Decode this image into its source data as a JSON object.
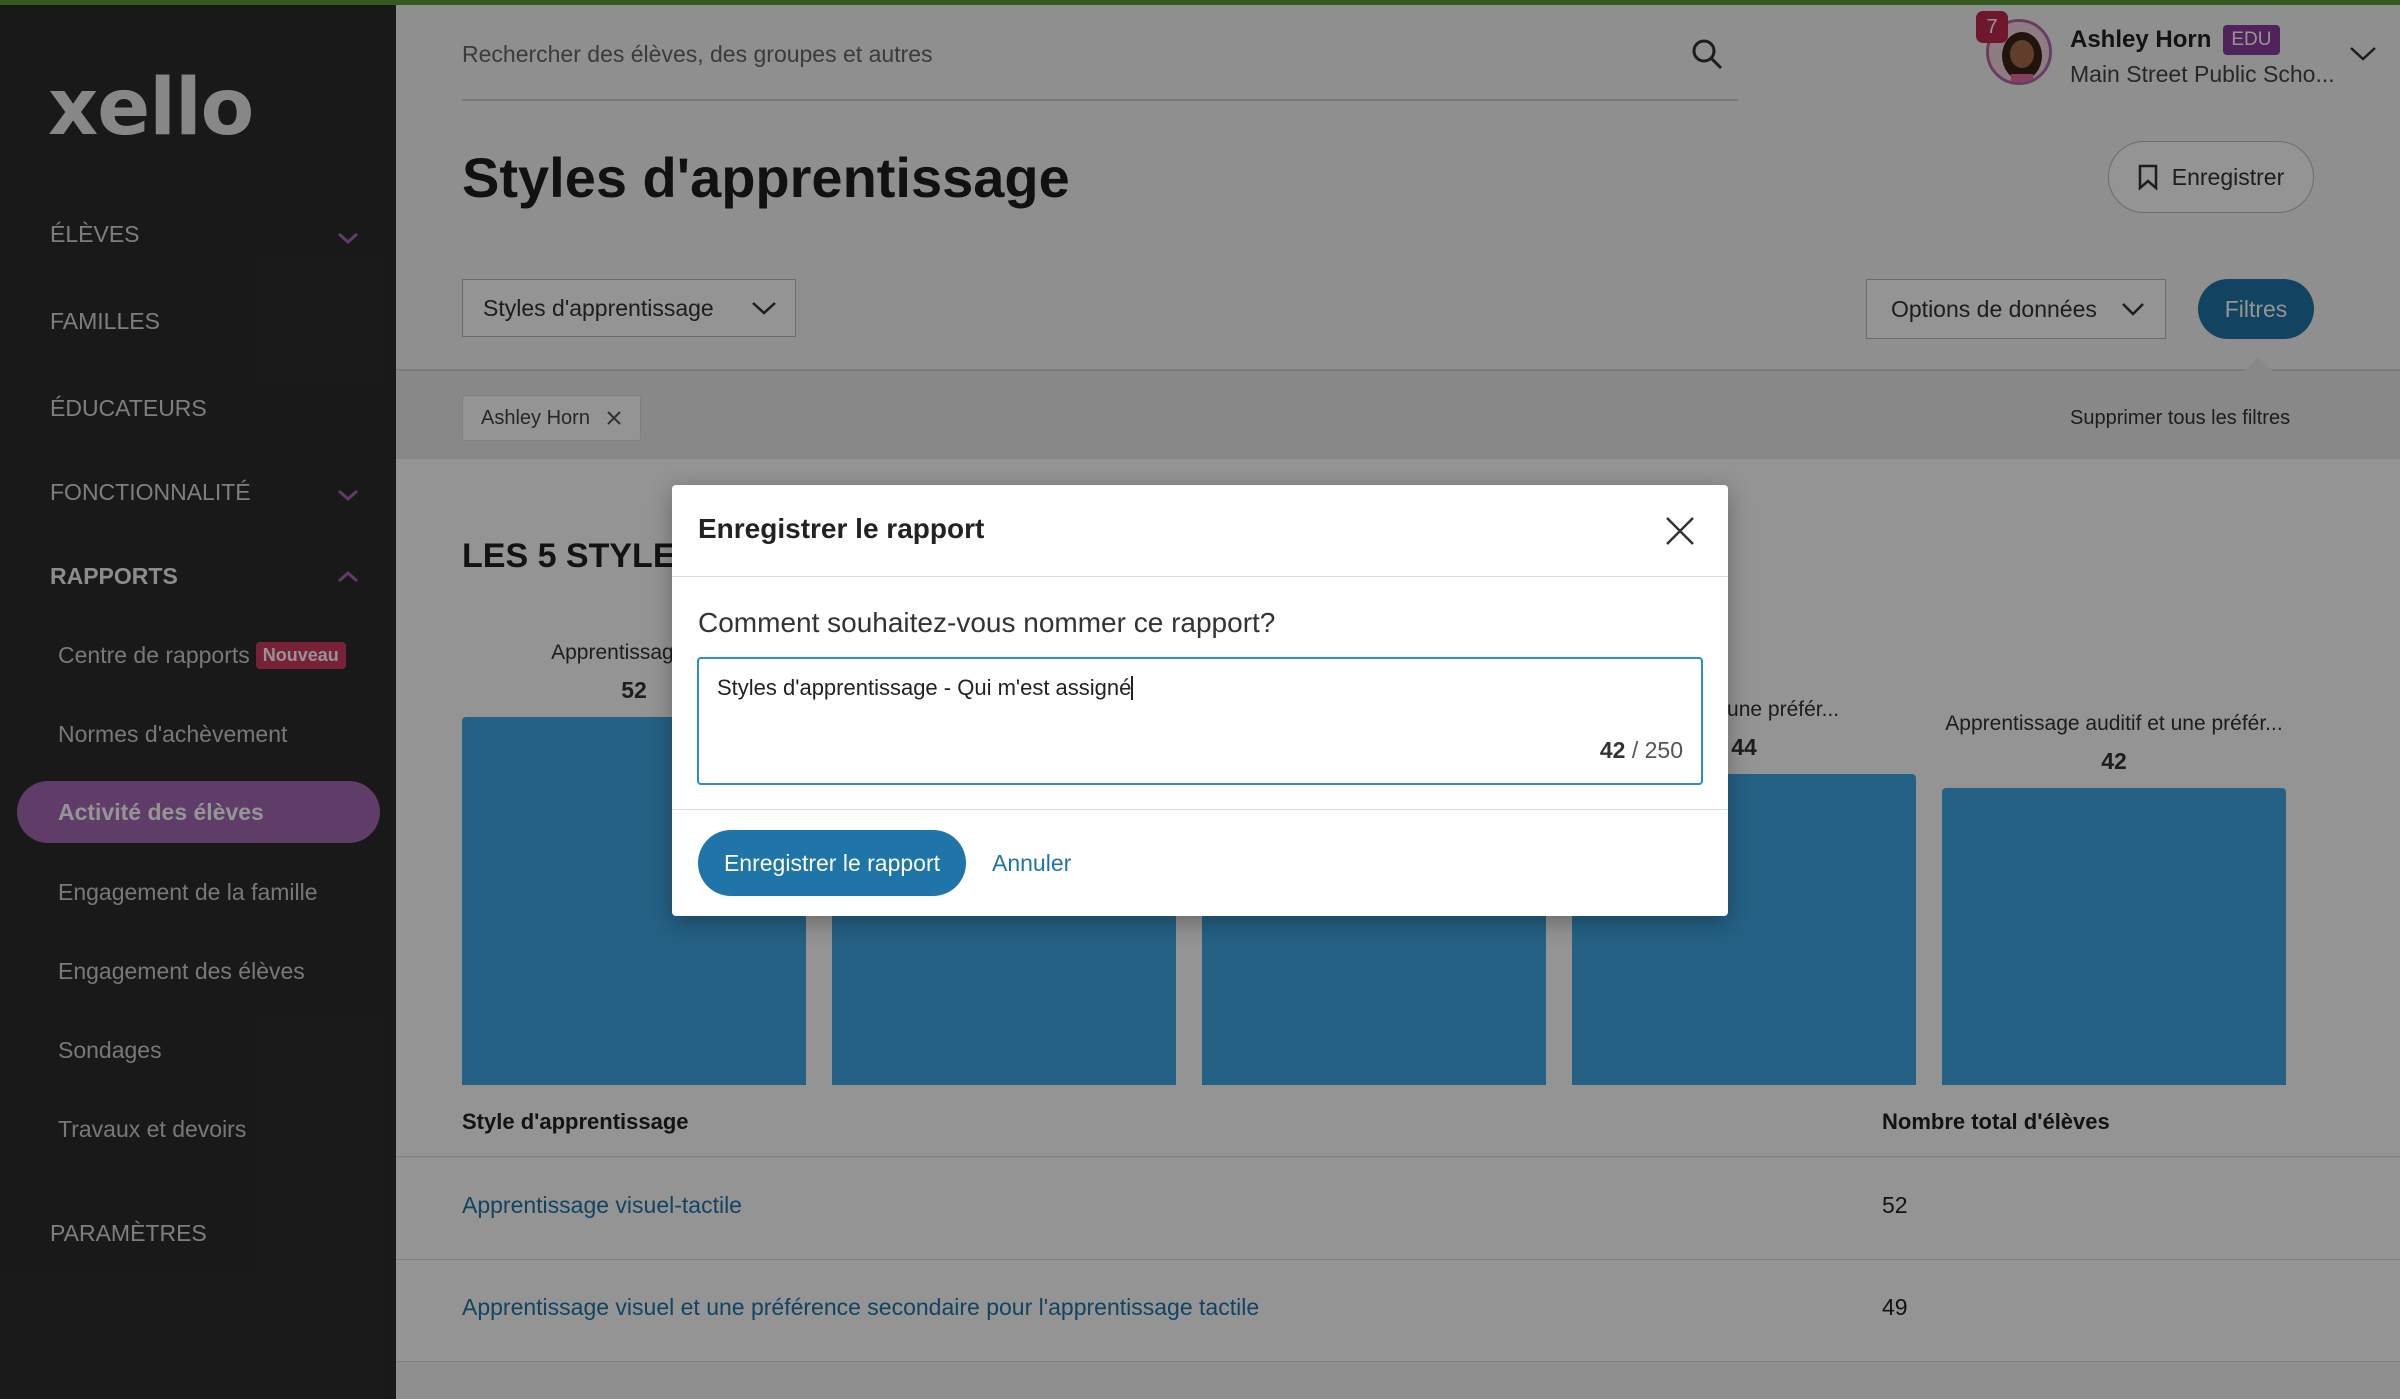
{
  "sidebar": {
    "logo": "xello",
    "items": [
      {
        "label": "ÉLÈVES"
      },
      {
        "label": "FAMILLES"
      },
      {
        "label": "ÉDUCATEURS"
      },
      {
        "label": "FONCTIONNALITÉ"
      },
      {
        "label": "RAPPORTS"
      }
    ],
    "sub_items": [
      {
        "label": "Centre de rapports",
        "badge": "Nouveau"
      },
      {
        "label": "Normes d'achèvement"
      },
      {
        "label": "Activité des élèves"
      },
      {
        "label": "Engagement de la famille"
      },
      {
        "label": "Engagement des élèves"
      },
      {
        "label": "Sondages"
      },
      {
        "label": "Travaux et devoirs"
      }
    ],
    "settings": "PARAMÈTRES",
    "active_color": "#a66ab3"
  },
  "header": {
    "search_placeholder": "Rechercher des élèves, des groupes et autres",
    "notifications": "7",
    "user_name": "Ashley Horn",
    "user_badge": "EDU",
    "school": "Main Street Public Scho..."
  },
  "page": {
    "title": "Styles d'apprentissage",
    "save_label": "Enregistrer",
    "report_select": "Styles d'apprentissage",
    "data_options": "Options de données",
    "filters_label": "Filtres",
    "filter_chip": "Ashley Horn",
    "clear_filters": "Supprimer tous les filtres",
    "accent": "#1f74a8"
  },
  "chart_data": {
    "type": "bar",
    "title": "LES 5 STYLES",
    "categories": [
      "Apprentissage vis",
      "",
      "",
      "actile et une préfér...",
      "Apprentissage auditif et une préfér..."
    ],
    "values": [
      52,
      49,
      null,
      44,
      42
    ],
    "value_labels": [
      "52",
      "",
      "",
      "44",
      "42"
    ],
    "bar_color": "#3ea7e4"
  },
  "table": {
    "headers": [
      "Style d'apprentissage",
      "Nombre total d'élèves"
    ],
    "rows": [
      {
        "style": "Apprentissage visuel-tactile",
        "count": "52"
      },
      {
        "style": "Apprentissage visuel et une préférence secondaire pour l'apprentissage tactile",
        "count": "49"
      }
    ]
  },
  "modal": {
    "title": "Enregistrer le rapport",
    "question": "Comment souhaitez-vous nommer ce rapport?",
    "input_value": "Styles d'apprentissage - Qui m'est assigné",
    "char_count": "42",
    "char_max": "/ 250",
    "save_button": "Enregistrer le rapport",
    "cancel_button": "Annuler"
  }
}
